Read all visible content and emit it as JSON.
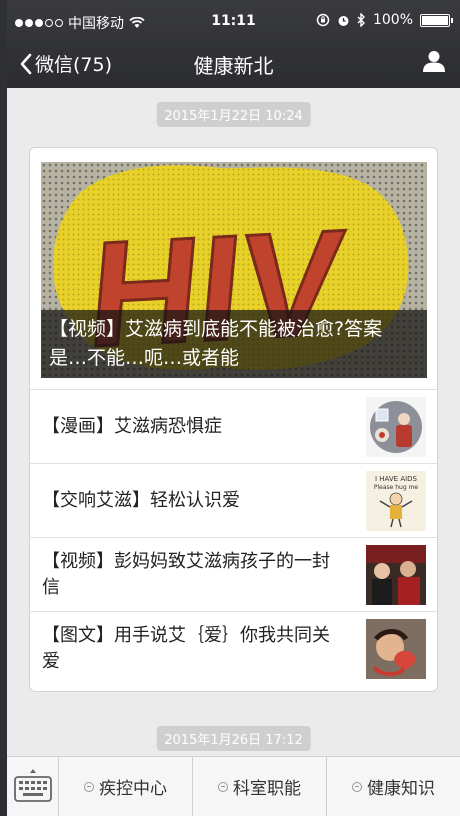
{
  "status_bar": {
    "carrier": "中国移动",
    "time": "11:11",
    "battery": "100%",
    "battery_level": 1.0
  },
  "nav": {
    "back_label": "微信(75)",
    "title": "健康新北"
  },
  "messages": [
    {
      "timestamp": "2015年1月22日 10:24",
      "cover": {
        "title": "【视频】艾滋病到底能不能被治愈?答案是…不能…呃…或者能",
        "image_text": "HIV"
      },
      "items": [
        {
          "title": "【漫画】艾滋病恐惧症"
        },
        {
          "title": "【交响艾滋】轻松认识爱",
          "image_text_1": "I HAVE AIDS",
          "image_text_2": "Please hug me"
        },
        {
          "title": "【视频】彭妈妈致艾滋病孩子的一封信"
        },
        {
          "title": "【图文】用手说艾｛爱｝你我共同关爱"
        }
      ]
    },
    {
      "timestamp": "2015年1月26日 17:12"
    }
  ],
  "menu": {
    "items": [
      {
        "label": "疾控中心"
      },
      {
        "label": "科室职能"
      },
      {
        "label": "健康知识"
      }
    ]
  },
  "colors": {
    "nav_bg": "#2b2c30",
    "page_bg": "#ebebeb",
    "timestamp_bg": "#cfcfcf"
  }
}
